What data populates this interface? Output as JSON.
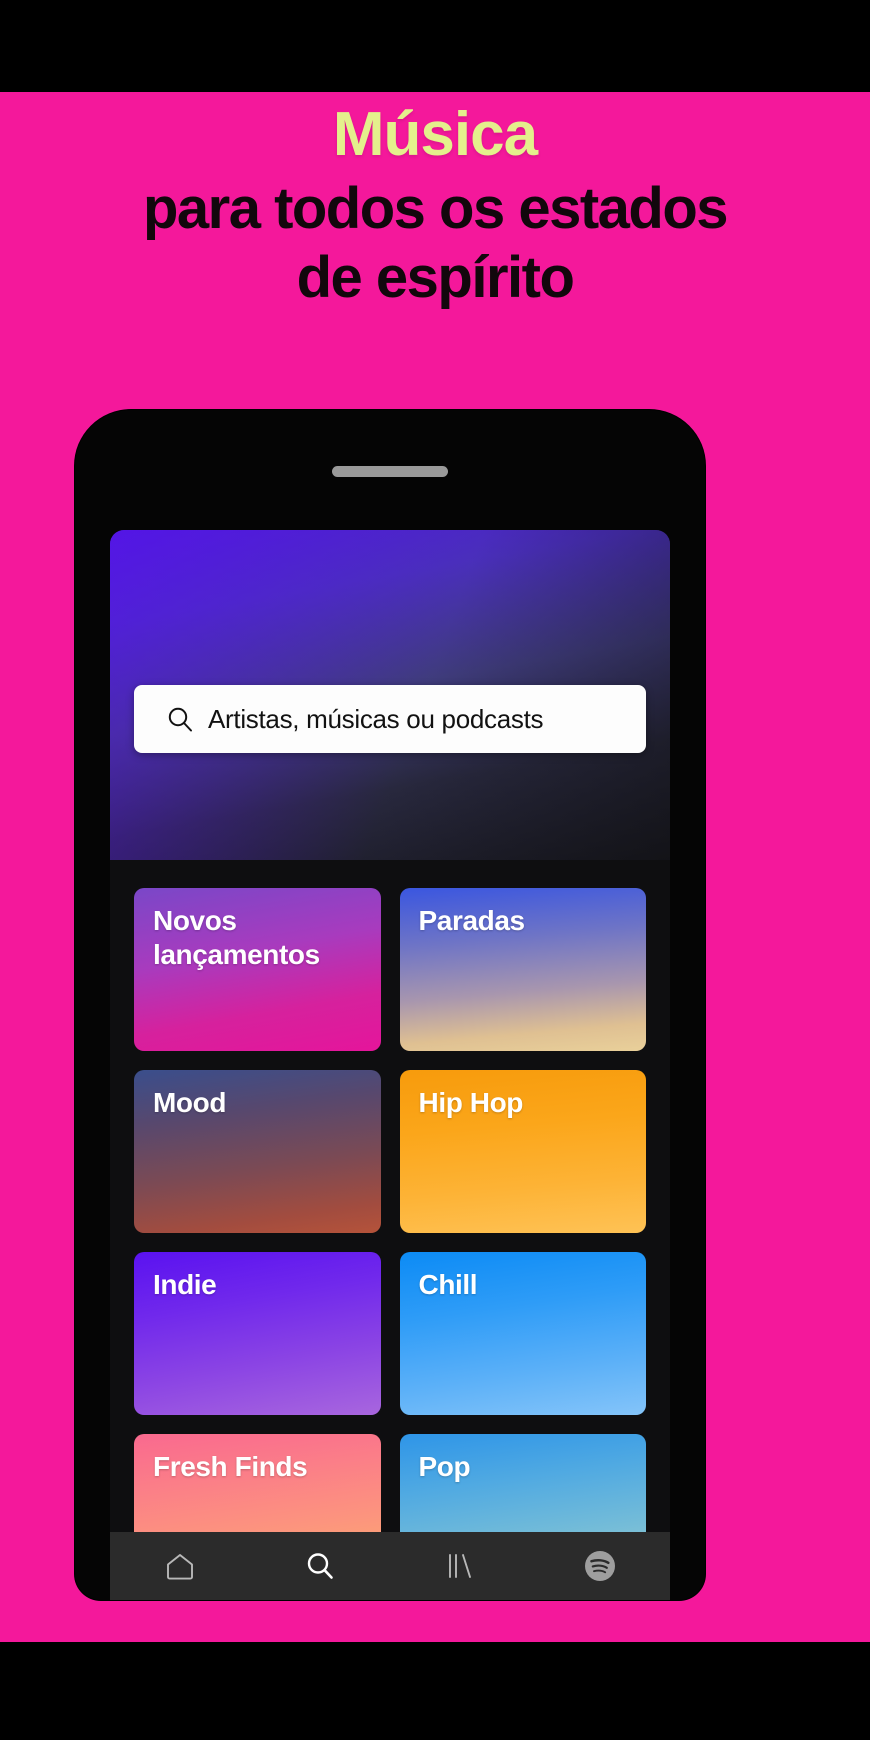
{
  "poster": {
    "background_color": "#F4189B",
    "headline": {
      "line1": "Música",
      "line1_color": "#E4F08C",
      "line2": "para todos os estados",
      "line3": "de espírito",
      "body_color": "#12070C"
    }
  },
  "phone": {
    "frame_color": "#050505",
    "speaker_name": "phone-speaker-grille"
  },
  "app": {
    "name": "Spotify",
    "screen": {
      "search": {
        "icon": "search-icon",
        "placeholder": "Artistas, músicas ou podcasts",
        "value": "",
        "background": "#FDFDFD",
        "text_color": "#121212"
      },
      "tiles": [
        {
          "label": "Novos lançamentos",
          "name": "tile-novos-lancamentos",
          "accent": "#D6219D"
        },
        {
          "label": "Paradas",
          "name": "tile-paradas",
          "accent": "#A896AE"
        },
        {
          "label": "Mood",
          "name": "tile-mood",
          "accent": "#A24C3F"
        },
        {
          "label": "Hip Hop",
          "name": "tile-hip-hop",
          "accent": "#FBA61A"
        },
        {
          "label": "Indie",
          "name": "tile-indie",
          "accent": "#7028EC"
        },
        {
          "label": "Chill",
          "name": "tile-chill",
          "accent": "#2E9CF7"
        },
        {
          "label": "Fresh Finds",
          "name": "tile-fresh-finds",
          "accent": "#FB7E88"
        },
        {
          "label": "Pop",
          "name": "tile-pop",
          "accent": "#4FA9E2"
        }
      ],
      "bottom_nav": {
        "background": "#2B2B2B",
        "items": [
          {
            "icon": "home-icon",
            "label": "Início",
            "active": false
          },
          {
            "icon": "search-icon",
            "label": "Pesquisar",
            "active": true
          },
          {
            "icon": "library-icon",
            "label": "Biblioteca",
            "active": false
          },
          {
            "icon": "spotify-logo-icon",
            "label": "Spotify",
            "active": false
          }
        ]
      }
    }
  }
}
